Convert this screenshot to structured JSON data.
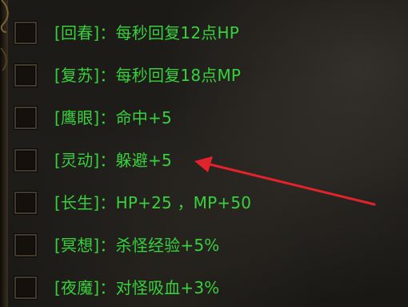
{
  "buffs": [
    {
      "text": "[回春]：每秒回复12点HP"
    },
    {
      "text": "[复苏]：每秒回复18点MP"
    },
    {
      "text": "[鹰眼]：命中+5"
    },
    {
      "text": "[灵动]：躲避+5"
    },
    {
      "text": "[长生]：HP+25 ，MP+50"
    },
    {
      "text": "[冥想]：杀怪经验+5%"
    },
    {
      "text": "[夜魔]：对怪吸血+3%"
    }
  ],
  "colors": {
    "text_green": "#37d13b",
    "annotation_arrow": "#e3232c",
    "background": "#1e1c19",
    "checkbox_border": "#433a2b"
  }
}
